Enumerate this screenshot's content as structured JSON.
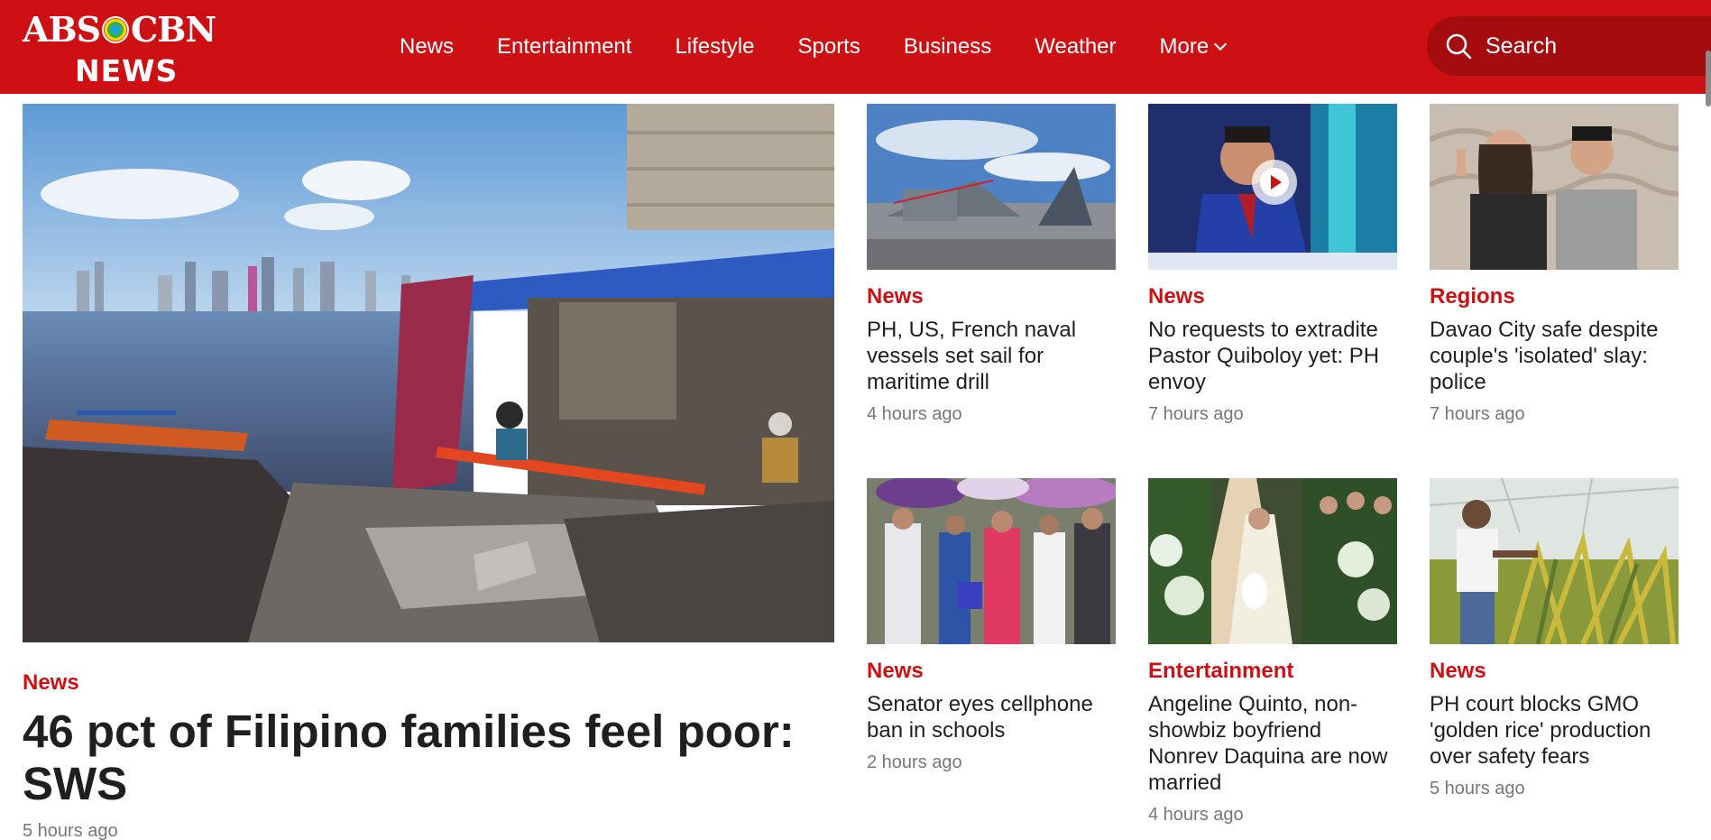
{
  "brand": {
    "logo_top": "ABS",
    "logo_top_right": "CBN",
    "logo_bottom": "NEWS"
  },
  "nav": {
    "items": [
      "News",
      "Entertainment",
      "Lifestyle",
      "Sports",
      "Business",
      "Weather",
      "More"
    ]
  },
  "search": {
    "label": "Search",
    "icon": "search-icon"
  },
  "hero": {
    "category": "News",
    "title": "46 pct of Filipino families feel poor: SWS",
    "time": "5 hours ago"
  },
  "cards": [
    {
      "category": "News",
      "title": "PH, US, French naval vessels set sail for maritime drill",
      "time": "4 hours ago"
    },
    {
      "category": "News",
      "title": "No requests to extradite Pastor Quiboloy yet: PH envoy",
      "time": "7 hours ago",
      "has_video": true
    },
    {
      "category": "Regions",
      "title": "Davao City safe despite couple's 'isolated' slay: police",
      "time": "7 hours ago"
    },
    {
      "category": "News",
      "title": "Senator eyes cellphone ban in schools",
      "time": "2 hours ago"
    },
    {
      "category": "Entertainment",
      "title": "Angeline Quinto, non-showbiz boyfriend Nonrev Daquina are now married",
      "time": "4 hours ago"
    },
    {
      "category": "News",
      "title": "PH court blocks GMO 'golden rice' production over safety fears",
      "time": "5 hours ago"
    }
  ],
  "colors": {
    "brand_red": "#cc1014",
    "search_bg": "#a50c10"
  }
}
